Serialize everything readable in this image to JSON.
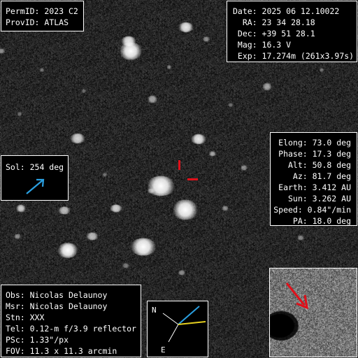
{
  "ident": {
    "perm_id": "PermID: 2023 C2",
    "prov_id": "ProvID: ATLAS"
  },
  "ephemeris": {
    "date": "Date: 2025 06 12.10022",
    "ra": "  RA: 23 34 28.18",
    "dec": " Dec: +39 51 28.1",
    "mag": " Mag: 16.3 V",
    "exp": " Exp: 17.274m (261x3.97s)"
  },
  "geometry": {
    "elong": "Elong: 73.0 deg",
    "phase": "Phase: 17.3 deg",
    "alt": "Alt: 50.8 deg",
    "az": "Az: 81.7 deg",
    "earth": "Earth: 3.412 AU",
    "sun": "Sun: 3.262 AU",
    "speed": "Speed: 0.84\"/min",
    "pa": "PA: 18.0 deg"
  },
  "sol": {
    "label": "Sol: 254 deg",
    "arrow_color": "#2a9fe0"
  },
  "observer": {
    "obs": "Obs: Nicolas Delaunoy",
    "msr": "Msr: Nicolas Delaunoy",
    "stn": "Stn: XXX",
    "tel": "Tel: 0.12-m f/3.9 reflector",
    "psc": "PSc: 1.33\"/px",
    "fov": "FOV: 11.3 x 11.3 arcmin"
  },
  "compass": {
    "north_label": "N",
    "east_label": "E",
    "motion_color": "#2a9fe0",
    "sun_color": "#e6d020"
  },
  "target_marker_color": "#e0101a"
}
